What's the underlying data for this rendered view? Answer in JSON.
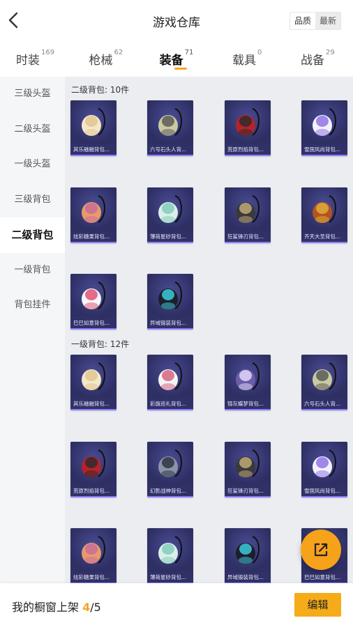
{
  "header": {
    "title": "游戏仓库",
    "sort_options": [
      {
        "label": "品质",
        "active": false
      },
      {
        "label": "最新",
        "active": true
      }
    ]
  },
  "tabs": [
    {
      "label": "时装",
      "count": "169",
      "active": false
    },
    {
      "label": "枪械",
      "count": "62",
      "active": false
    },
    {
      "label": "装备",
      "count": "71",
      "active": true
    },
    {
      "label": "载具",
      "count": "0",
      "active": false
    },
    {
      "label": "战备",
      "count": "29",
      "active": false
    }
  ],
  "sidebar": {
    "items": [
      {
        "label": "三级头盔",
        "active": false
      },
      {
        "label": "二级头盔",
        "active": false
      },
      {
        "label": "一级头盔",
        "active": false
      },
      {
        "label": "三级背包",
        "active": false
      },
      {
        "label": "二级背包",
        "active": true
      },
      {
        "label": "一级背包",
        "active": false
      },
      {
        "label": "背包挂件",
        "active": false
      }
    ]
  },
  "sections": [
    {
      "title": "二级背包: 10件",
      "items": [
        {
          "name": "其乐融融背包...",
          "icon": "cream-bag-icon"
        },
        {
          "name": "六号石头人背...",
          "icon": "stone-bag-icon"
        },
        {
          "name": "荒原烈焰背包...",
          "icon": "flame-bag-icon"
        },
        {
          "name": "雪国风尚背包...",
          "icon": "snow-bag-icon"
        },
        {
          "name": "炫彩糖果背包...",
          "icon": "candy-bag-icon"
        },
        {
          "name": "薄荷星砂背包...",
          "icon": "mint-bag-icon"
        },
        {
          "name": "狂鲨锋刃背包...",
          "icon": "shark-bag-icon"
        },
        {
          "name": "齐天大圣背包...",
          "icon": "monkey-bag-icon"
        },
        {
          "name": "巳巳如意背包...",
          "icon": "snake-bag-icon"
        },
        {
          "name": "异域锻装背包...",
          "icon": "forge-bag-icon"
        }
      ]
    },
    {
      "title": "一级背包: 12件",
      "items": [
        {
          "name": "其乐融融背包...",
          "icon": "cream-bag-icon"
        },
        {
          "name": "彩旗巡礼背包...",
          "icon": "flag-bag-icon"
        },
        {
          "name": "锦灰蝶梦背包...",
          "icon": "butterfly-bag-icon"
        },
        {
          "name": "六号石头人背...",
          "icon": "stone-bag-icon"
        },
        {
          "name": "荒原烈焰背包...",
          "icon": "flame-bag-icon"
        },
        {
          "name": "幻影战神背包...",
          "icon": "phantom-bag-icon"
        },
        {
          "name": "狂鲨锋刃背包...",
          "icon": "shark-bag-icon"
        },
        {
          "name": "雪国风尚背包...",
          "icon": "snow-bag-icon"
        },
        {
          "name": "炫彩糖果背包...",
          "icon": "candy-bag-icon"
        },
        {
          "name": "薄荷星砂背包...",
          "icon": "mint-bag-icon"
        },
        {
          "name": "异域锻装背包...",
          "icon": "forge-bag-icon"
        },
        {
          "name": "巳巳如意背包...",
          "icon": "snake-bag-icon"
        }
      ]
    }
  ],
  "footer": {
    "label": "我的橱窗上架",
    "current": "4",
    "separator": "/",
    "total": "5",
    "edit_label": "编辑"
  },
  "colors": {
    "accent": "#f5a623",
    "card_bg": "#3a3a72",
    "sidebar_bg": "#f5f6f8",
    "content_bg": "#ebedf1"
  }
}
